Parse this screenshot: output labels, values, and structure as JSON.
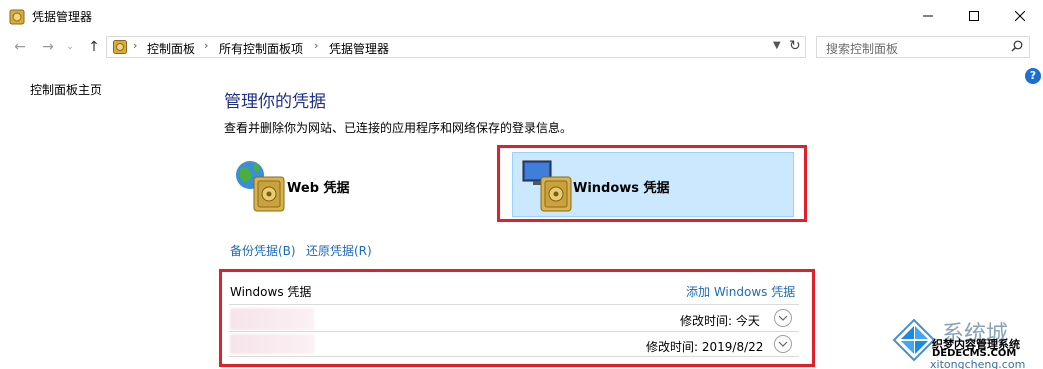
{
  "window": {
    "title": "凭据管理器",
    "icon": "vault-icon",
    "buttons": [
      "minimize",
      "maximize",
      "close"
    ]
  },
  "nav": {
    "breadcrumbs": [
      "控制面板",
      "所有控制面板项",
      "凭据管理器"
    ],
    "search_placeholder": "搜索控制面板"
  },
  "sidebar": {
    "home_link": "控制面板主页"
  },
  "main": {
    "heading": "管理你的凭据",
    "description": "查看并删除你为网站、已连接的应用程序和网络保存的登录信息。",
    "web_credentials_label": "Web 凭据",
    "windows_credentials_label": "Windows 凭据",
    "windows_selected": true,
    "backup_link": "备份凭据(B)",
    "restore_link": "还原凭据(R)"
  },
  "section": {
    "title": "Windows 凭据",
    "add_link": "添加 Windows 凭据",
    "items": [
      {
        "name": "",
        "modified": "修改时间:  今天"
      },
      {
        "name": "",
        "modified": "修改时间:  2019/8/22"
      }
    ]
  },
  "watermark": {
    "big": "系统城",
    "caption": "织梦内容管理系统",
    "url": "DEDECMS.COM",
    "sub": "xitongcheng.com"
  },
  "colors": {
    "heading": "#1e3287",
    "link": "#1e6bb8",
    "selection_bg": "#cce8ff",
    "highlight_box": "#e0202a"
  }
}
